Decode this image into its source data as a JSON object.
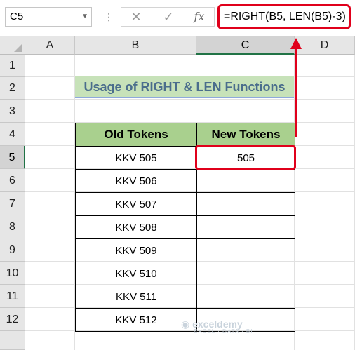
{
  "formula_bar": {
    "name_box": "C5",
    "formula": "=RIGHT(B5, LEN(B5)-3)",
    "fx_label": "fx"
  },
  "columns": [
    "A",
    "B",
    "C",
    "D"
  ],
  "active_column": "C",
  "rows": [
    "1",
    "2",
    "3",
    "4",
    "5",
    "6",
    "7",
    "8",
    "9",
    "10",
    "11",
    "12"
  ],
  "active_row": "5",
  "title": "Usage of RIGHT & LEN Functions",
  "table": {
    "headers": [
      "Old Tokens",
      "New Tokens"
    ],
    "rows": [
      [
        "KKV 505",
        "505"
      ],
      [
        "KKV 506",
        ""
      ],
      [
        "KKV 507",
        ""
      ],
      [
        "KKV 508",
        ""
      ],
      [
        "KKV 509",
        ""
      ],
      [
        "KKV 510",
        ""
      ],
      [
        "KKV 511",
        ""
      ],
      [
        "KKV 512",
        ""
      ]
    ]
  },
  "watermark": {
    "brand": "exceldemy",
    "tagline": "EXCEL · DATA · BI"
  },
  "colors": {
    "highlight": "#e0001b",
    "title_fill": "#c7e2b9",
    "title_text": "#4a6d8c",
    "header_fill": "#a9d08e",
    "active_header": "#217346"
  }
}
